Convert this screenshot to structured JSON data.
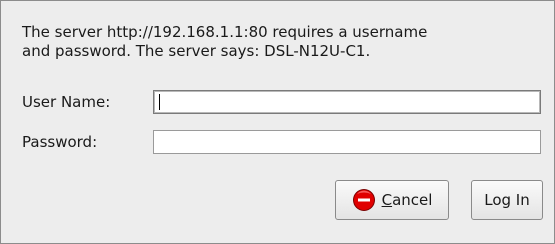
{
  "dialog": {
    "message_line1": "The server http://192.168.1.1:80 requires a username",
    "message_line2": "and password. The server says: DSL-N12U-C1."
  },
  "form": {
    "username_label": "User Name:",
    "username_value": "",
    "password_label": "Password:",
    "password_value": ""
  },
  "buttons": {
    "cancel_label": "Cancel",
    "cancel_icon": "stop-icon",
    "login_label": "Log In"
  },
  "colors": {
    "stop_icon_red": "#e00000"
  }
}
